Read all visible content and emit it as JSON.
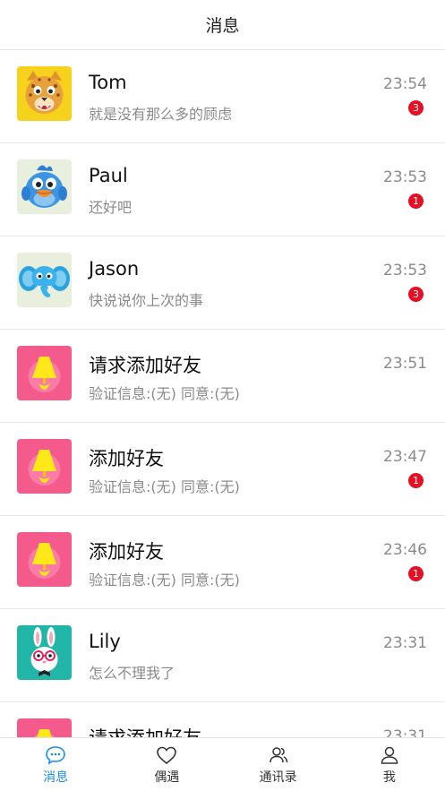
{
  "header": {
    "title": "消息"
  },
  "conversations": [
    {
      "name": "Tom",
      "preview": "就是没有那么多的顾虑",
      "time": "23:54",
      "unread": "3",
      "avatar": "leopard-avatar"
    },
    {
      "name": "Paul",
      "preview": "还好吧",
      "time": "23:53",
      "unread": "1",
      "avatar": "bird-avatar"
    },
    {
      "name": "Jason",
      "preview": "快说说你上次的事",
      "time": "23:53",
      "unread": "3",
      "avatar": "elephant-avatar"
    },
    {
      "name": "请求添加好友",
      "preview": "验证信息:(无) 同意:(无)",
      "time": "23:51",
      "unread": "",
      "avatar": "lamp-avatar"
    },
    {
      "name": "添加好友",
      "preview": "验证信息:(无) 同意:(无)",
      "time": "23:47",
      "unread": "1",
      "avatar": "lamp-avatar"
    },
    {
      "name": "添加好友",
      "preview": "验证信息:(无) 同意:(无)",
      "time": "23:46",
      "unread": "1",
      "avatar": "lamp-avatar"
    },
    {
      "name": "Lily",
      "preview": "怎么不理我了",
      "time": "23:31",
      "unread": "",
      "avatar": "rabbit-avatar"
    },
    {
      "name": "请求添加好友",
      "preview": "",
      "time": "23:31",
      "unread": "",
      "avatar": "lamp-avatar"
    }
  ],
  "tabbar": {
    "tabs": [
      {
        "label": "消息",
        "icon": "chat-bubble-icon",
        "active": true
      },
      {
        "label": "偶遇",
        "icon": "heart-icon",
        "active": false
      },
      {
        "label": "通讯录",
        "icon": "contacts-icon",
        "active": false
      },
      {
        "label": "我",
        "icon": "person-icon",
        "active": false
      }
    ]
  },
  "colors": {
    "accent": "#1a8ceb",
    "badge": "#e60f23",
    "lamp_bg": "#f45b8c",
    "leopard_bg": "#f7d21d",
    "rabbit_bg": "#22b6a8"
  }
}
